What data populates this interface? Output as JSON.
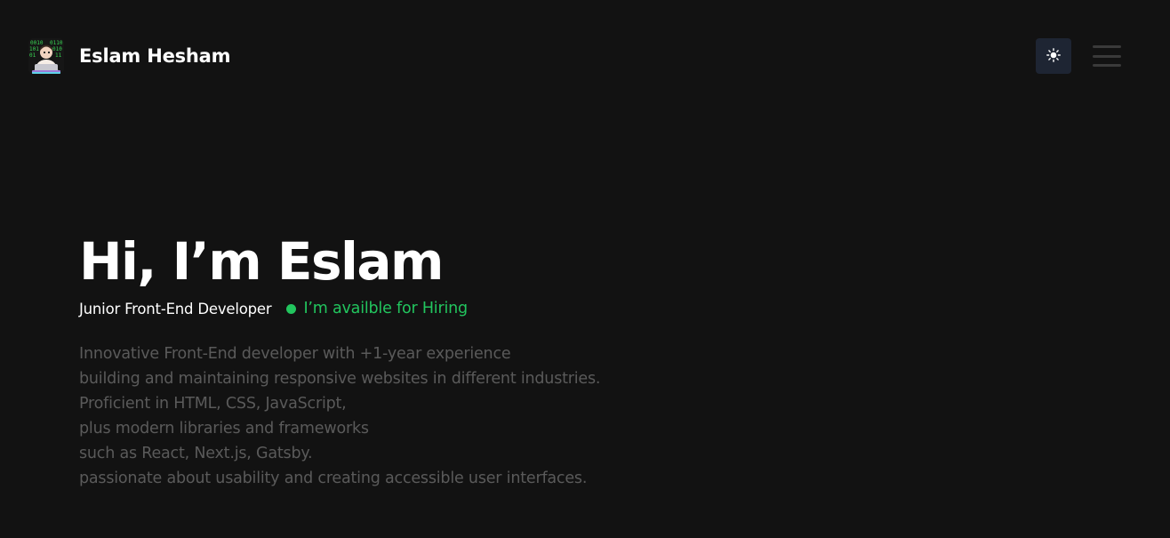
{
  "header": {
    "brand_name": "Eslam Hesham",
    "avatar_icon": "coder-avatar-icon",
    "theme_toggle_icon": "sun-icon",
    "menu_icon": "hamburger-menu-icon"
  },
  "hero": {
    "title": "Hi, I’m Eslam",
    "role": "Junior Front-End Developer",
    "status_text": "I’m availble for Hiring",
    "bio_lines": [
      "Innovative Front-End developer with +1-year experience",
      "building and maintaining responsive websites in different industries.",
      "Proficient in HTML, CSS, JavaScript,",
      "plus modern libraries and frameworks",
      "such as React, Next.js, Gatsby.",
      "passionate about usability and creating accessible user interfaces."
    ]
  },
  "colors": {
    "background": "#121212",
    "accent_green": "#22c55e",
    "muted_text": "#5a5a5a",
    "toggle_bg": "#1e2533"
  }
}
